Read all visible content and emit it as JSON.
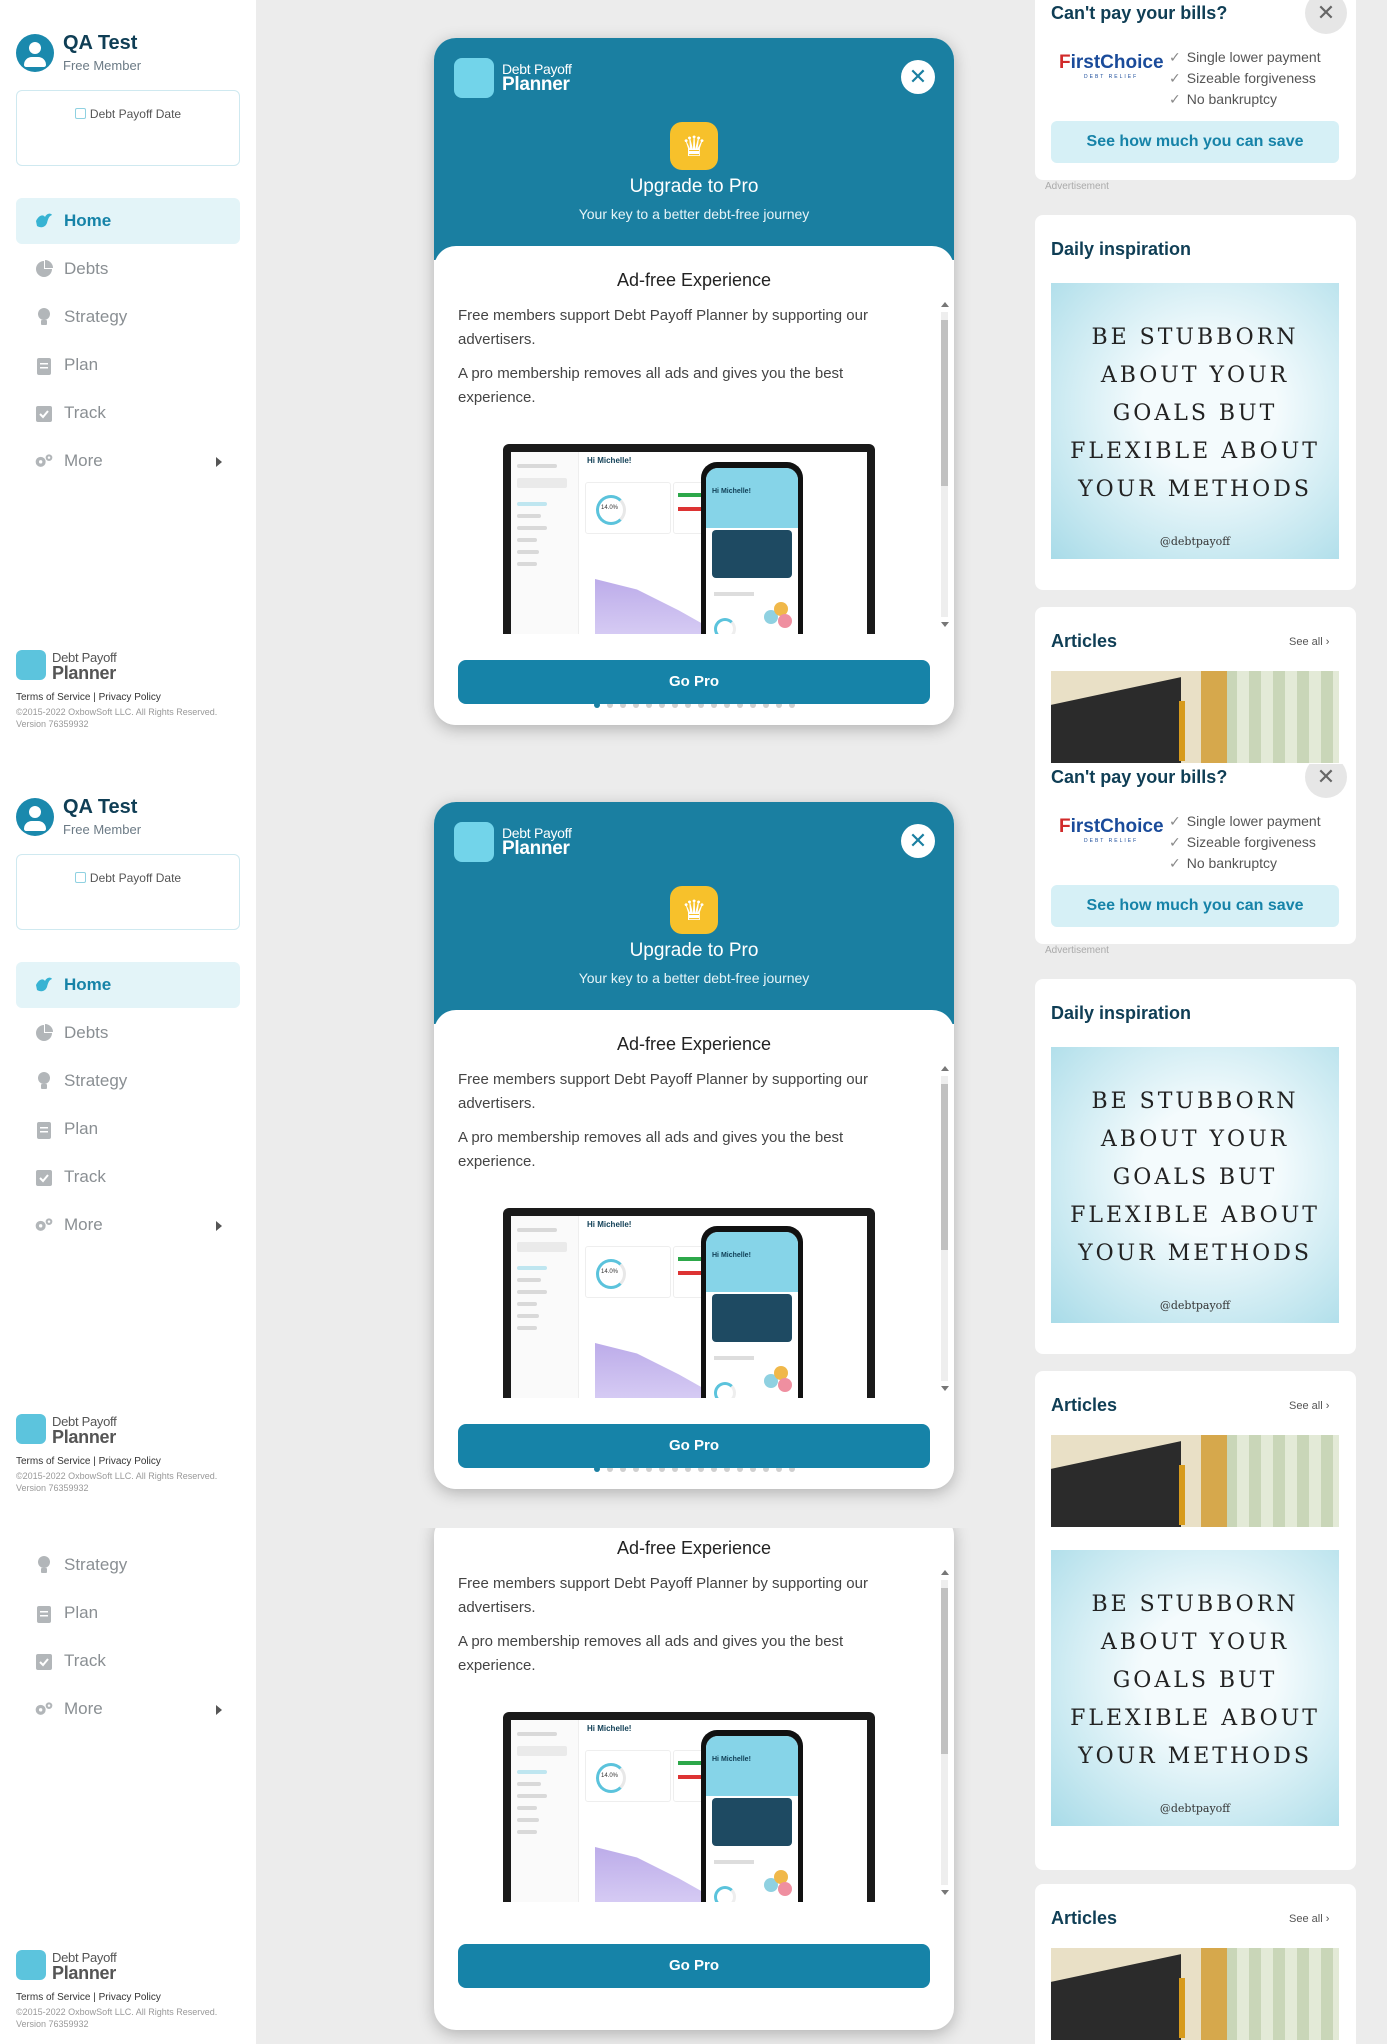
{
  "user": {
    "name": "QA Test",
    "role": "Free Member"
  },
  "date_card": {
    "label": "Debt Payoff Date"
  },
  "nav": [
    {
      "label": "Home",
      "icon": "bird-icon"
    },
    {
      "label": "Debts",
      "icon": "pie-chart-icon"
    },
    {
      "label": "Strategy",
      "icon": "lightbulb-icon"
    },
    {
      "label": "Plan",
      "icon": "clipboard-icon"
    },
    {
      "label": "Track",
      "icon": "calendar-check-icon"
    },
    {
      "label": "More",
      "icon": "gears-icon"
    }
  ],
  "brand": {
    "line1": "Debt Payoff",
    "line2": "Planner"
  },
  "footer": {
    "terms": "Terms of Service",
    "sep": "|",
    "privacy": "Privacy Policy",
    "copyright": "©2015-2022 OxbowSoft LLC. All Rights Reserved.",
    "version": "Version 76359932"
  },
  "modal": {
    "close": "✕",
    "title": "Upgrade to Pro",
    "subtitle": "Your key to a better debt-free journey",
    "section_title": "Ad-free Experience",
    "para1": "Free members support Debt Payoff Planner by supporting our advertisers.",
    "para2": "A pro membership removes all ads and gives you the best experience.",
    "cta": "Go Pro",
    "slides_total": 16,
    "slide_active": 1,
    "preview": {
      "greeting": "Hi Michelle!",
      "percent": "14.0%",
      "phone_greeting": "Hi Michelle!"
    }
  },
  "ad": {
    "question": "Can't pay your bills?",
    "close": "✕",
    "brand_f": "F",
    "brand_rest": "irstChoice",
    "brand_sub": "DEBT RELIEF",
    "bullets": [
      "Single lower payment",
      "Sizeable forgiveness",
      "No bankruptcy"
    ],
    "cta": "See how much you can save",
    "label": "Advertisement"
  },
  "inspiration": {
    "title": "Daily inspiration",
    "quote": "BE STUBBORN ABOUT YOUR GOALS BUT FLEXIBLE ABOUT YOUR METHODS",
    "handle": "@debtpayoff"
  },
  "articles": {
    "title": "Articles",
    "see_all": "See all ›"
  },
  "colors": {
    "primary": "#1a7fa1",
    "accent": "#1683a8",
    "crown": "#f7c12b",
    "sidebar_active_bg": "#e3f4f8"
  }
}
